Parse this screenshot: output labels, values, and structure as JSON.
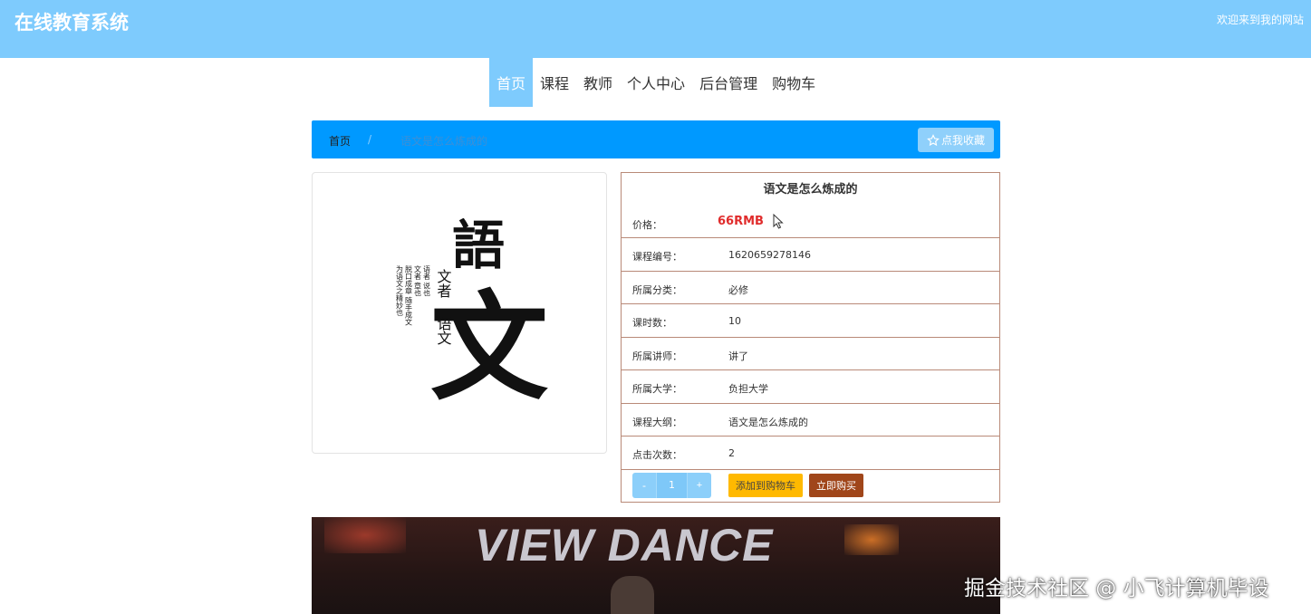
{
  "header": {
    "site_title": "在线教育系统",
    "welcome_text": "欢迎来到我的网站"
  },
  "nav": {
    "items": [
      {
        "label": "首页",
        "active": true
      },
      {
        "label": "课程",
        "active": false
      },
      {
        "label": "教师",
        "active": false
      },
      {
        "label": "个人中心",
        "active": false
      },
      {
        "label": "后台管理",
        "active": false
      },
      {
        "label": "购物车",
        "active": false
      }
    ]
  },
  "breadcrumb": {
    "home": "首页",
    "separator": "/",
    "current": "语文是怎么炼成的",
    "favorite_label": "点我收藏",
    "favorite_icon": "star-outline-icon"
  },
  "cover": {
    "big_char_1": "語",
    "big_char_2": "文",
    "small_1": "文者",
    "small_2": "语文",
    "col_1": "语者 说也",
    "col_2": "文者 章也",
    "col_3": "脱口成章 随手成文",
    "col_4": "为语文之精妙也"
  },
  "course": {
    "title": "语文是怎么炼成的",
    "price_label": "价格：",
    "price_value": "66RMB",
    "rows": [
      {
        "label": "课程编号：",
        "value": "1620659278146"
      },
      {
        "label": "所属分类：",
        "value": "必修"
      },
      {
        "label": "课时数：",
        "value": "10"
      },
      {
        "label": "所属讲师：",
        "value": "讲了"
      },
      {
        "label": "所属大学：",
        "value": "负担大学"
      },
      {
        "label": "课程大纲：",
        "value": "语文是怎么炼成的"
      },
      {
        "label": "点击次数：",
        "value": "2"
      }
    ]
  },
  "actions": {
    "minus": "-",
    "quantity": "1",
    "plus": "+",
    "add_to_cart": "添加到购物车",
    "buy_now": "立即购买"
  },
  "video": {
    "banner_text": "VIEW DANCE"
  },
  "watermark": "掘金技术社区 @ 小飞计算机毕设",
  "colors": {
    "header_bg": "#7ecbfd",
    "breadcrumb_bg": "#0099ff",
    "price": "#e02c2c",
    "add_cart": "#ffb900",
    "buy_now": "#a0461a"
  }
}
